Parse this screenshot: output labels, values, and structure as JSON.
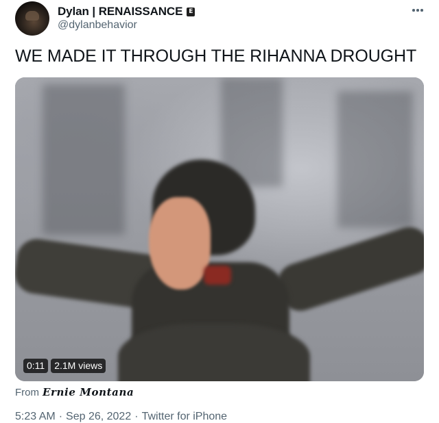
{
  "author": {
    "display_name": "Dylan | RENAISSANCE",
    "label_badge": "E",
    "handle": "@dylanbehavior"
  },
  "tweet": {
    "text": "WE MADE IT THROUGH THE RIHANNA DROUGHT"
  },
  "video": {
    "duration": "0:11",
    "views": "2.1M views"
  },
  "attribution": {
    "prefix": "From",
    "source": "Ernie Montana"
  },
  "meta": {
    "time": "5:23 AM",
    "date": "Sep 26, 2022",
    "client": "Twitter for iPhone",
    "separator": "·"
  },
  "icons": {
    "more": "more-horizontal-icon"
  },
  "colors": {
    "text_primary": "#0f1419",
    "text_secondary": "#536471",
    "background": "#ffffff"
  }
}
